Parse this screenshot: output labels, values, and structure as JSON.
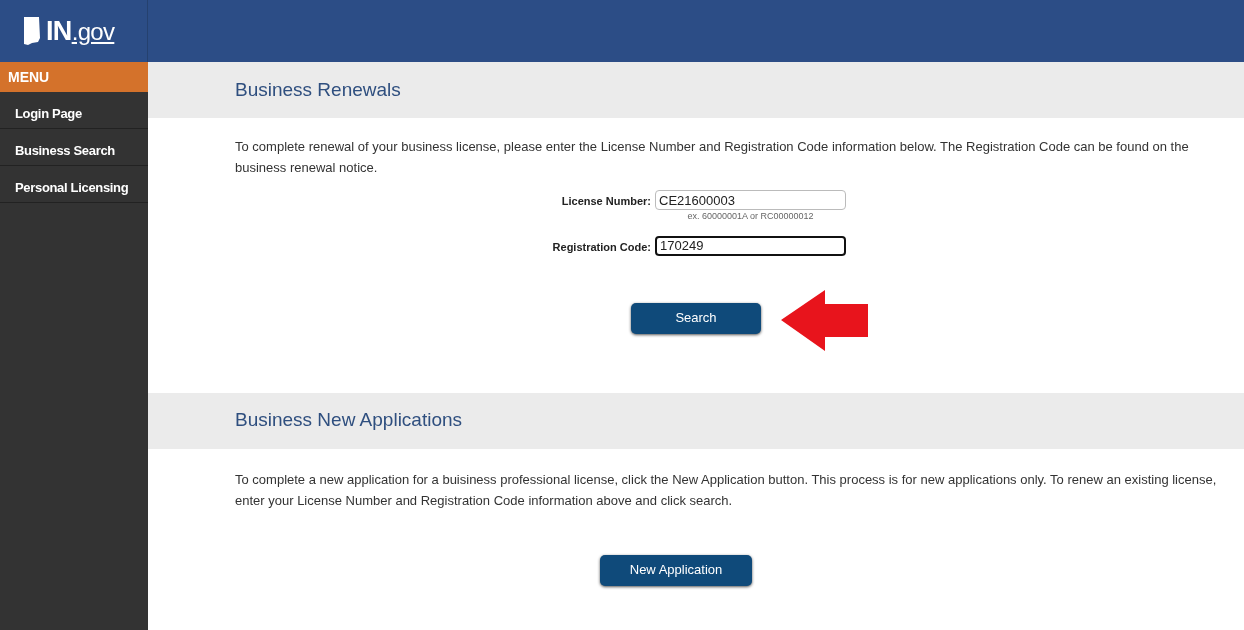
{
  "header": {
    "logo": {
      "state": "IN",
      "domain": ".gov"
    }
  },
  "sidebar": {
    "title": "MENU",
    "items": [
      {
        "label": "Login Page"
      },
      {
        "label": "Business Search"
      },
      {
        "label": "Personal Licensing"
      }
    ]
  },
  "renewals": {
    "title": "Business Renewals",
    "intro": "To complete renewal of your business license, please enter the License Number and Registration Code information below. The Registration Code can be found on the business renewal notice.",
    "fields": [
      {
        "label": "License Number:",
        "value": "CE21600003",
        "hint": "ex. 60000001A or RC00000012",
        "focused": false
      },
      {
        "label": "Registration Code:",
        "value": "170249",
        "focused": true
      }
    ],
    "button": "Search"
  },
  "new_applications": {
    "title": "Business New Applications",
    "intro": "To complete a new application for a buisiness professional license, click the New Application button. This process is for new applications only. To renew an existing license, enter your License Number and Registration Code information above and click search.",
    "button": "New Application"
  }
}
